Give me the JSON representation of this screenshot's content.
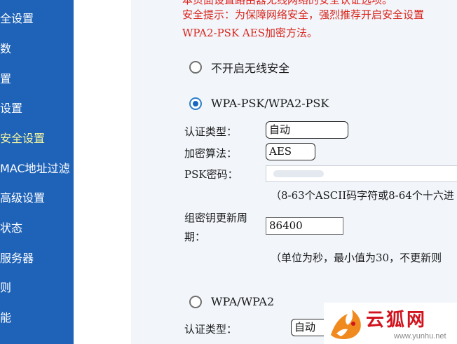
{
  "sidebar": {
    "items": [
      {
        "label": "全设置"
      },
      {
        "label": "数"
      },
      {
        "label": "置"
      },
      {
        "label": "设置"
      },
      {
        "label": "安全设置",
        "active": true
      },
      {
        "label": "MAC地址过滤"
      },
      {
        "label": "高级设置"
      },
      {
        "label": "状态"
      },
      {
        "label": "服务器"
      },
      {
        "label": "则"
      },
      {
        "label": "能"
      }
    ]
  },
  "security": {
    "cut_line": "本页面设置路由器无线网络的安全认证选项。",
    "warning_line1": "安全提示：为保障网络安全，强烈推荐开启安全设置",
    "warning_line2": "WPA2-PSK AES加密方法。",
    "option_none": {
      "label": "不开启无线安全",
      "checked": false
    },
    "option_psk": {
      "label": "WPA-PSK/WPA2-PSK",
      "checked": true,
      "auth_type_label": "认证类型：",
      "auth_type_value": "自动",
      "encryption_label": "加密算法：",
      "encryption_value": "AES",
      "psk_label": "PSK密码：",
      "psk_hint": "（8-63个ASCII码字符或8-64个十六进",
      "group_key_label_1": "组密钥更新周",
      "group_key_label_2": "期：",
      "group_key_value": "86400",
      "group_key_hint": "（单位为秒，最小值为30，不更新则"
    },
    "option_wpa": {
      "label": "WPA/WPA2",
      "checked": false,
      "auth_type_label": "认证类型：",
      "auth_type_value": "自动"
    }
  },
  "watermark": {
    "text": "云狐网",
    "url": "www.yunhu.net"
  },
  "colors": {
    "sidebar_bg": "#1f63b8",
    "warning": "#d8261c",
    "content_bg": "#f2f6fb"
  }
}
